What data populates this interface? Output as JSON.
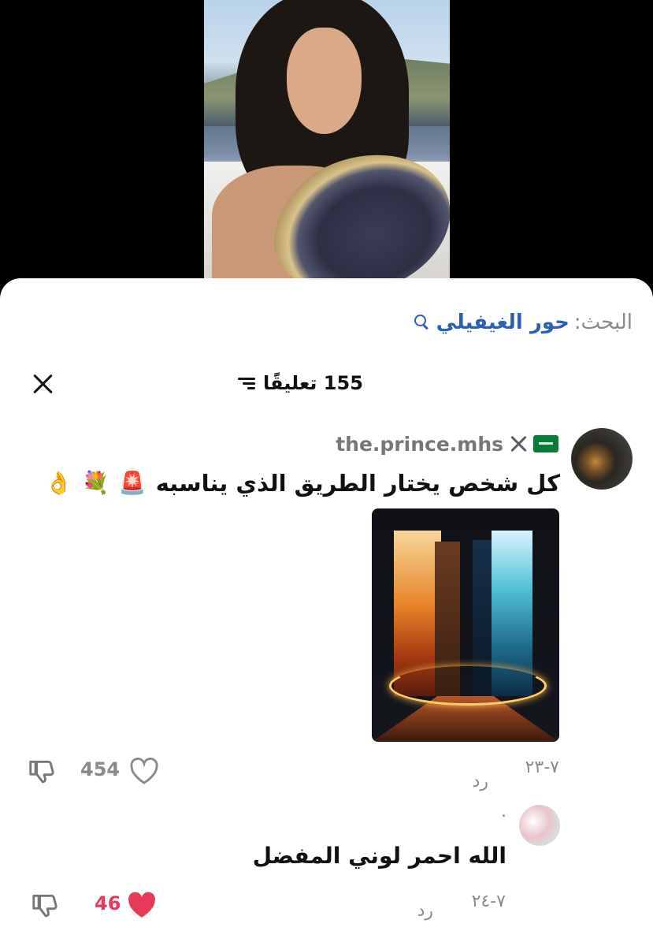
{
  "video": {
    "description_hidden": ""
  },
  "sheet": {
    "search": {
      "label": "البحث:",
      "term": "حور الغيفيلي"
    },
    "header": {
      "count_text": "155 تعليقًا"
    },
    "comments": [
      {
        "username": "the.prince.mhs",
        "text": "كل شخص يختار الطريق الذي يناسبه",
        "emojis": [
          "🚨",
          "💐",
          "👌"
        ],
        "date": "٧-٢٣",
        "reply_label": "رد",
        "likes": "454"
      },
      {
        "username": ".",
        "text": "الله احمر لوني المفضل",
        "date": "٧-٢٤",
        "reply_label": "رد",
        "likes": "46"
      }
    ],
    "partial_line": "ـ ـ ـ ـ ـ ـ"
  },
  "colors": {
    "link": "#2f5fb3",
    "muted": "#8a8a8a",
    "liked": "#e8395a"
  }
}
